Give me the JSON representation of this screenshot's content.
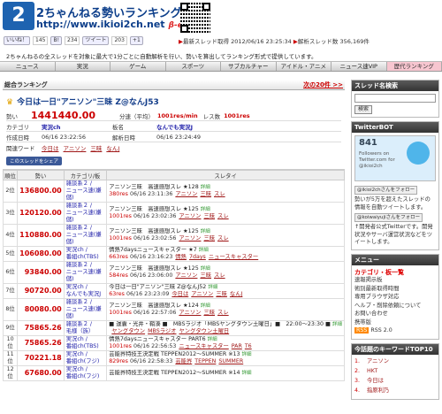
{
  "header": {
    "logo_mark": "2勢",
    "title": "2ちゃんねる勢いランキング",
    "url": "http://www.ikioi2ch.net",
    "beta": "β-eta",
    "like_label": "いいね！",
    "like_count": "145",
    "hatena_count": "234",
    "tweet_label": "ツイート",
    "tweet_count": "203",
    "plus_label": "+1",
    "latest_label": "最新スレッド取得",
    "latest_time": "2012/06/16 23:25:34",
    "analyzed_label": "解析スレッド数",
    "analyzed_count": "356,169件",
    "description": "2ちゃんねるの全スレッドを対象に最大で1分ごとに自動解析を行い、勢いを算出してランキング形式で提供しています。"
  },
  "nav": [
    "ニュース",
    "実況",
    "ゲーム",
    "スポーツ",
    "サブカルチャー",
    "アイドル・アニメ",
    "ニュース速VIP",
    "歴代ランキング"
  ],
  "main": {
    "section_title": "総合ランキング",
    "next_link": "次の20件 >>",
    "featured": {
      "title": "今日は一日\"アニソン\"三昧 Z@なんJ53",
      "ikioi_label": "勢い",
      "ikioi": "1441440.00",
      "avg_label": "分速（平均）",
      "avg": "1001res/min",
      "res_label": "レス数",
      "res": "1001res",
      "cat_label": "カテゴリ",
      "cat": "実況ch",
      "board_label": "板名",
      "board": "なんでも実況J",
      "created_label": "作成日時",
      "created": "06/16 23:22:56",
      "analyzed_label": "解析日時",
      "analyzed": "06/16 23:24:49",
      "kw_label": "関連ワード",
      "keywords": [
        "今日は",
        "アニソン",
        "三昧",
        "なんJ"
      ],
      "fb_button": "このスレッドをシェア"
    },
    "table_headers": [
      "順位",
      "勢い",
      "カテゴリ/板",
      "スレタイ"
    ],
    "rows": [
      {
        "rank": "2位",
        "ikioi": "136800.00",
        "cat1": "雑談系２ /",
        "cat2": "ニュース速(嫌儲)",
        "t1": "アニソン三昧　高速感想スレ ★128",
        "t2": "380res",
        "t3": "06/16 23:11:36",
        "w": [
          "アニソン",
          "三昧",
          "スレ"
        ]
      },
      {
        "rank": "3位",
        "ikioi": "120120.00",
        "cat1": "雑談系２ /",
        "cat2": "ニュース速(嫌儲)",
        "t1": "アニソン三昧　高速感想スレ ★125",
        "t2": "1001res",
        "t3": "06/16 23:02:36",
        "w": [
          "アニソン",
          "三昧",
          "スレ"
        ]
      },
      {
        "rank": "4位",
        "ikioi": "110880.00",
        "cat1": "雑談系２ /",
        "cat2": "ニュース速(嫌儲)",
        "t1": "アニソン三昧　高速感想スレ ★125",
        "t2": "1001res",
        "t3": "06/16 23:02:56",
        "w": [
          "アニソン",
          "三昧",
          "スレ"
        ]
      },
      {
        "rank": "5位",
        "ikioi": "106080.00",
        "cat1": "実況ch /",
        "cat2": "番組ch(TBS)",
        "t1": "情熱7daysニュースキャスター ★7",
        "t2": "663res",
        "t3": "06/16 23:16:23",
        "w": [
          "情熱",
          "7days",
          "ニュースキャスター"
        ]
      },
      {
        "rank": "6位",
        "ikioi": "93840.00",
        "cat1": "雑談系２ /",
        "cat2": "ニュース速(嫌儲)",
        "t1": "アニソン三昧　高速感想スレ ★125",
        "t2": "584res",
        "t3": "06/16 23:06:00",
        "w": [
          "アニソン",
          "三昧",
          "スレ"
        ]
      },
      {
        "rank": "7位",
        "ikioi": "90720.00",
        "cat1": "実況ch /",
        "cat2": "なんでも実況J",
        "t1": "今日は一日\"アニソン\"三昧 Z@なんJ52",
        "t2": "63res",
        "t3": "06/16 23:23:09",
        "w": [
          "今日は",
          "アニソン",
          "三昧",
          "なんJ"
        ]
      },
      {
        "rank": "8位",
        "ikioi": "80080.00",
        "cat1": "雑談系２ /",
        "cat2": "ニュース速(嫌儲)",
        "t1": "アニソン三昧　高速感想スレ ★124",
        "t2": "1001res",
        "t3": "06/16 22:57:06",
        "w": [
          "アニソン",
          "三昧",
          "スレ"
        ]
      },
      {
        "rank": "9位",
        "ikioi": "75865.26",
        "cat1": "雑談系２ /",
        "cat2": "毛様（族）",
        "t1": "■ 運囊・光井・鞘湊 ■　MBSラジオ「MBSヤングタウン土曜日」■　22:00～23:30 ■",
        "t2": "",
        "t3": "",
        "w": [
          "ヤングタウン",
          "MBSラジオ",
          "ヤングタウン土曜日"
        ]
      },
      {
        "rank": "10位",
        "ikioi": "75865.26",
        "cat1": "実況ch /",
        "cat2": "番組ch(TBS)",
        "t1": "情熱7daysニュースキャスター PART6",
        "t2": "1001res",
        "t3": "06/16 22:56:53",
        "w": [
          "ニュースキャスター",
          "PAR",
          "T6"
        ]
      },
      {
        "rank": "11位",
        "ikioi": "70221.18",
        "cat1": "実況ch /",
        "cat2": "番組ch(フジ)",
        "t1": "芸能界特技王決定戦 TEPPEN2012～SUMMER ※13",
        "t2": "829res",
        "t3": "06/16 22:58:33",
        "w": [
          "芸能界",
          "TEPPEN",
          "SUMMER"
        ]
      },
      {
        "rank": "12位",
        "ikioi": "67680.00",
        "cat1": "実況ch /",
        "cat2": "番組ch(フジ)",
        "t1": "芸能界特技王決定戦 TEPPEN2012～SUMMER ※14",
        "t2": "",
        "t3": "",
        "w": []
      }
    ]
  },
  "side": {
    "search_title": "スレッド名検索",
    "search_button": "検索",
    "tw_title": "TwitterBOT",
    "tw_count": "841",
    "tw_followers": "Followers on Twitter.com for @ikioi2ch",
    "follow1": "@ikioi2chさんをフォロー",
    "tw_text": "勢いが5万を超えたスレッドの情報を自動ツイートします。",
    "follow2": "@koiwaiyujiさんをフォロー",
    "tw_text2": "↑開発者公式Twitterです。開発状況やサーバ運営状況などをツイートします。",
    "menu_title": "メニュー",
    "menu_head": "カテゴリ・板一覧",
    "menu_items": [
      "速報掲示板",
      "術別最新取得時間",
      "専用ブラウザ対応",
      "ヘルプ・削除依頼について",
      "お問い合わせ",
      "携帯版"
    ],
    "rss": "RSS 2.0",
    "kw_title": "今話題のキーワードTOP10",
    "kw": [
      "アニソン",
      "HKT",
      "今日は",
      "指原利乃"
    ]
  }
}
